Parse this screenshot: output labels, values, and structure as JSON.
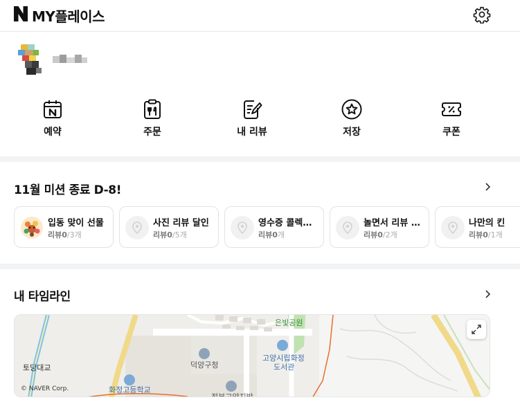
{
  "header": {
    "title": "MY플레이스"
  },
  "quick_menu": [
    {
      "label": "예약",
      "icon": "calendar-n-icon"
    },
    {
      "label": "주문",
      "icon": "order-clipboard-icon"
    },
    {
      "label": "내 리뷰",
      "icon": "review-pen-icon"
    },
    {
      "label": "저장",
      "icon": "star-icon"
    },
    {
      "label": "쿠폰",
      "icon": "coupon-icon"
    }
  ],
  "missions": {
    "title": "11월 미션 종료 D-8!",
    "cards": [
      {
        "name": "입동 맞이 선물",
        "done": "리뷰0",
        "total": "/3개"
      },
      {
        "name": "사진 리뷰 달인",
        "done": "리뷰0",
        "total": "/5개"
      },
      {
        "name": "영수증 콜렉…",
        "done": "리뷰0",
        "total": "개"
      },
      {
        "name": "놀면서 리뷰 …",
        "done": "리뷰0",
        "total": "/2개"
      },
      {
        "name": "나만의 킨",
        "done": "리뷰0",
        "total": "/1개"
      }
    ]
  },
  "timeline": {
    "title": "내 타임라인",
    "map_labels": {
      "park": "은빛공원",
      "library_1": "고양시립화정",
      "library_2": "도서관",
      "gu_office": "덕양구청",
      "bridge": "토당대교",
      "school": "화정고등학교",
      "bottom": "정부고양지방",
      "copyright": "© NAVER Corp."
    }
  },
  "colors": {
    "accent_green": "#03c75a",
    "text_dark": "#111111",
    "muted": "#aaaaaa",
    "divider": "#f2f3f5"
  }
}
